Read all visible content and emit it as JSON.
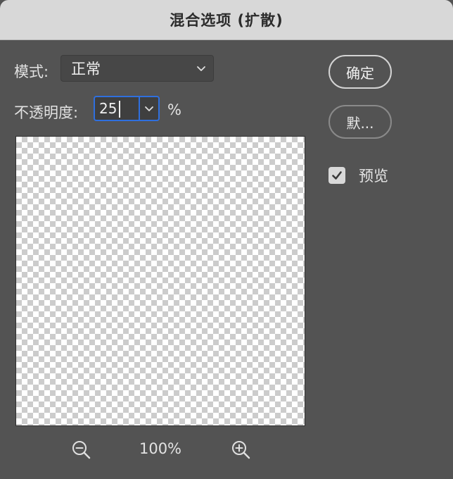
{
  "dialog": {
    "title": "混合选项 (扩散)"
  },
  "mode": {
    "label": "模式:",
    "value": "正常"
  },
  "opacity": {
    "label": "不透明度:",
    "value": "25",
    "unit": "%"
  },
  "zoom": {
    "level": "100%"
  },
  "buttons": {
    "ok": "确定",
    "reset": "默..."
  },
  "preview_option": {
    "label": "预览",
    "checked": true
  },
  "colors": {
    "accent": "#2f6fde",
    "panel": "#535353",
    "titlebar": "#d8d8d8"
  },
  "icons": [
    "chevron-down-icon",
    "zoom-out-icon",
    "zoom-in-icon",
    "checkmark-icon"
  ]
}
